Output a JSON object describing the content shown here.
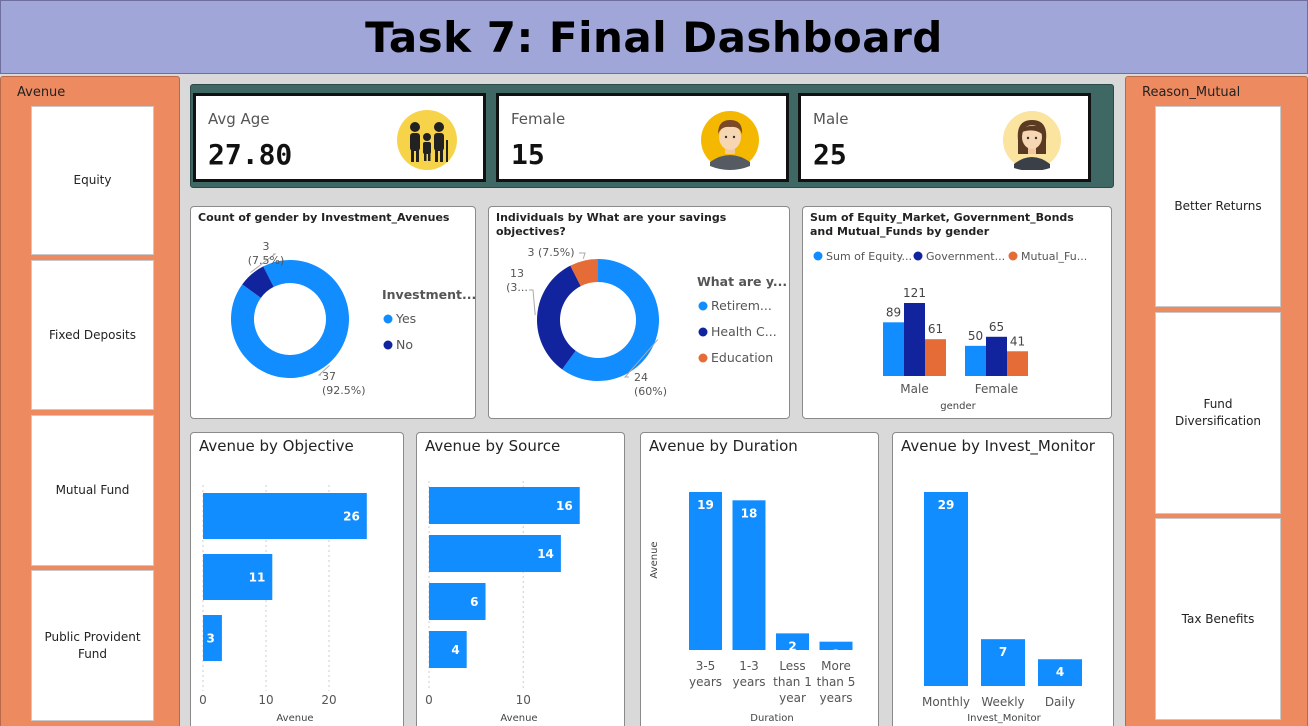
{
  "page_title": "Task 7: Final Dashboard",
  "left_slicer": {
    "label": "Avenue",
    "items": [
      "Equity",
      "Fixed Deposits",
      "Mutual Fund",
      "Public Provident Fund"
    ]
  },
  "right_slicer": {
    "label": "Reason_Mutual",
    "items": [
      "Better Returns",
      "Fund Diversification",
      "Tax Benefits"
    ]
  },
  "kpis": [
    {
      "label": "Avg Age",
      "value": "27.80",
      "icon": "family-icon"
    },
    {
      "label": "Female",
      "value": "15",
      "icon": "male-avatar-icon"
    },
    {
      "label": "Male",
      "value": "25",
      "icon": "female-avatar-icon"
    }
  ],
  "colors": {
    "blue": "#118dff",
    "navy": "#12239e",
    "orange": "#e66c37",
    "kpi_strip": "#3f6864",
    "side_panel": "#ee8a60",
    "title_bar": "#a0a6d8"
  },
  "chart_data": [
    {
      "type": "pie",
      "variant": "donut",
      "title": "Count of gender by Investment_Avenues",
      "legend_title": "Investment...",
      "labels": [
        "Yes",
        "No"
      ],
      "values": [
        37,
        3
      ],
      "data_labels": [
        "37\n(92.5%)",
        "3\n(7.5%)"
      ],
      "colors": [
        "#118dff",
        "#12239e"
      ]
    },
    {
      "type": "pie",
      "variant": "donut",
      "title": "Individuals by What are your savings objectives?",
      "legend_title": "What are y...",
      "labels": [
        "Retirem...",
        "Health C...",
        "Education"
      ],
      "values": [
        24,
        13,
        3
      ],
      "data_labels": [
        "24\n(60%)",
        "13\n(3...",
        "3 (7.5%)"
      ],
      "colors": [
        "#118dff",
        "#12239e",
        "#e66c37"
      ]
    },
    {
      "type": "bar",
      "title": "Sum of Equity_Market, Government_Bonds and Mutual_Funds by gender",
      "xlabel": "gender",
      "categories": [
        "Male",
        "Female"
      ],
      "legend": [
        "Sum of Equity...",
        "Government...",
        "Mutual_Fu..."
      ],
      "series": [
        {
          "name": "Sum of Equity...",
          "values": [
            89,
            50
          ],
          "color": "#118dff"
        },
        {
          "name": "Government...",
          "values": [
            121,
            65
          ],
          "color": "#12239e"
        },
        {
          "name": "Mutual_Fu...",
          "values": [
            61,
            41
          ],
          "color": "#e66c37"
        }
      ]
    },
    {
      "type": "bar",
      "orientation": "horizontal",
      "title": "Avenue by Objective",
      "xlabel": "Avenue",
      "values": [
        26,
        11,
        3
      ],
      "xticks": [
        "0",
        "10",
        "20"
      ],
      "xlim": [
        0,
        30
      ]
    },
    {
      "type": "bar",
      "orientation": "horizontal",
      "title": "Avenue by Source",
      "xlabel": "Avenue",
      "values": [
        16,
        14,
        6,
        4
      ],
      "xticks": [
        "0",
        "10"
      ],
      "xlim": [
        0,
        19
      ]
    },
    {
      "type": "bar",
      "title": "Avenue by Duration",
      "xlabel": "Duration",
      "ylabel": "Avenue",
      "categories": [
        "3-5 years",
        "1-3 years",
        "Less than 1 year",
        "More than 5 years"
      ],
      "category_lines": [
        [
          "3-5",
          "years"
        ],
        [
          "1-3",
          "years"
        ],
        [
          "Less",
          "than 1",
          "year"
        ],
        [
          "More",
          "than 5",
          "years"
        ]
      ],
      "values": [
        19,
        18,
        2,
        1
      ]
    },
    {
      "type": "bar",
      "title": "Avenue by Invest_Monitor",
      "xlabel": "Invest_Monitor",
      "categories": [
        "Monthly",
        "Weekly",
        "Daily"
      ],
      "values": [
        29,
        7,
        4
      ]
    }
  ]
}
